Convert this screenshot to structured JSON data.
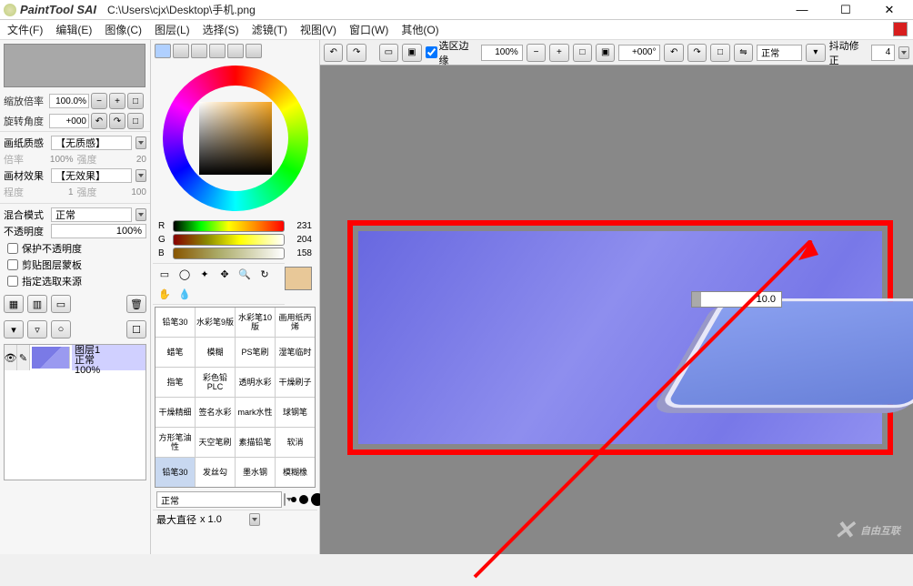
{
  "title": {
    "app": "PaintTool SAI",
    "path": "C:\\Users\\cjx\\Desktop\\手机.png"
  },
  "menu": [
    "文件(F)",
    "编辑(E)",
    "图像(C)",
    "图层(L)",
    "选择(S)",
    "滤镜(T)",
    "视图(V)",
    "窗口(W)",
    "其他(O)"
  ],
  "zoom": {
    "label": "缩放倍率",
    "value": "100.0%"
  },
  "rotate": {
    "label": "旋转角度",
    "value": "+000"
  },
  "paper": {
    "label": "画纸质感",
    "value": "【无质感】",
    "mag_label": "倍率",
    "mag": "100%",
    "str_label": "强度",
    "str": "20"
  },
  "effect": {
    "label": "画材效果",
    "value": "【无效果】",
    "prog_label": "程度",
    "prog": "1",
    "str_label": "强度",
    "str": "100"
  },
  "blend": {
    "label": "混合模式",
    "value": "正常"
  },
  "opacity": {
    "label": "不透明度",
    "value": "100%"
  },
  "checks": {
    "c1": "保护不透明度",
    "c2": "剪贴图层蒙板",
    "c3": "指定选取来源"
  },
  "layer": {
    "name": "图层1",
    "mode": "正常",
    "op": "100%"
  },
  "rgb": {
    "r": "231",
    "g": "204",
    "b": "158"
  },
  "brushes": [
    "铅笔30",
    "水彩笔9版",
    "水彩笔10版",
    "画用纸丙烯",
    "蜡笔",
    "模糊",
    "PS笔刷",
    "湿笔临时",
    "指笔",
    "彩色铅PLC",
    "透明水彩",
    "干燥刷子",
    "干燥精细",
    "签名水彩",
    "mark水性",
    "球钢笔",
    "方形笔油性",
    "天空笔刷",
    "素描铅笔",
    "软消",
    "铅笔30",
    "发丝勾",
    "墨水钢",
    "模糊橡"
  ],
  "brush_mode": "正常",
  "maxd": {
    "label": "最大直径",
    "value": "x 1.0"
  },
  "toolbar": {
    "edge": "选区边缘",
    "zoom": "100%",
    "angle": "+000°",
    "mode": "正常",
    "shake_label": "抖动修正",
    "shake": "4"
  },
  "canvas_input": "10.0",
  "watermark": "自由互联"
}
